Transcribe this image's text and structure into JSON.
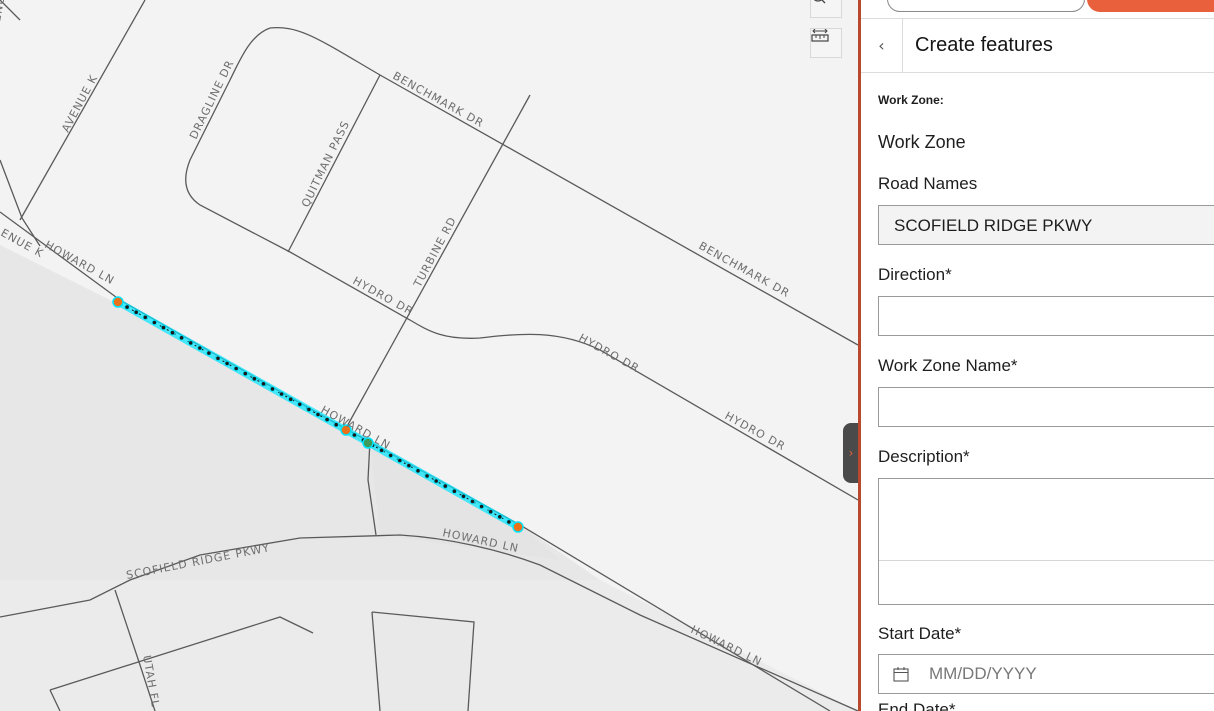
{
  "map": {
    "road_labels": {
      "avenue_k": "AVENUE K",
      "dragline_dr": "DRAGLINE DR",
      "quitman_pass": "QUITMAN PASS",
      "benchmark_dr_1": "BENCHMARK DR",
      "benchmark_dr_2": "BENCHMARK DR",
      "turbine_rd": "TURBINE RD",
      "hydro_dr_1": "HYDRO DR",
      "hydro_dr_2": "HYDRO DR",
      "hydro_dr_3": "HYDRO DR",
      "avenue_partial": "ENUE",
      "avenue_partial_2": "ENUE K",
      "howard_ln_1": "HOWARD LN",
      "howard_ln_2": "HOWARD LN",
      "howard_ln_3": "HOWARD LN",
      "howard_ln_4": "HOWARD LN",
      "scofield_ridge_pkwy": "SCOFIELD RIDGE PKWY",
      "utah_fl": "UTAH FL"
    },
    "controls": {
      "search_icon": "search-icon",
      "measure_icon": "measure-icon"
    },
    "colors": {
      "selection": "#00e5ff",
      "vertex": "#e8711a",
      "road": "#5a5a5a"
    }
  },
  "panel": {
    "title": "Create features",
    "layer_label": "Work Zone:",
    "layer_name": "Work Zone",
    "fields": {
      "road_names_label": "Road Names",
      "road_names_value": "SCOFIELD RIDGE PKWY",
      "direction_label": "Direction*",
      "direction_value": "",
      "work_zone_name_label": "Work Zone Name*",
      "work_zone_name_value": "",
      "description_label": "Description*",
      "description_value": "",
      "description_counter": "(",
      "start_date_label": "Start Date*",
      "start_date_placeholder": "MM/DD/YYYY",
      "end_date_label": "End Date*"
    },
    "accent_color": "#e8603c"
  }
}
